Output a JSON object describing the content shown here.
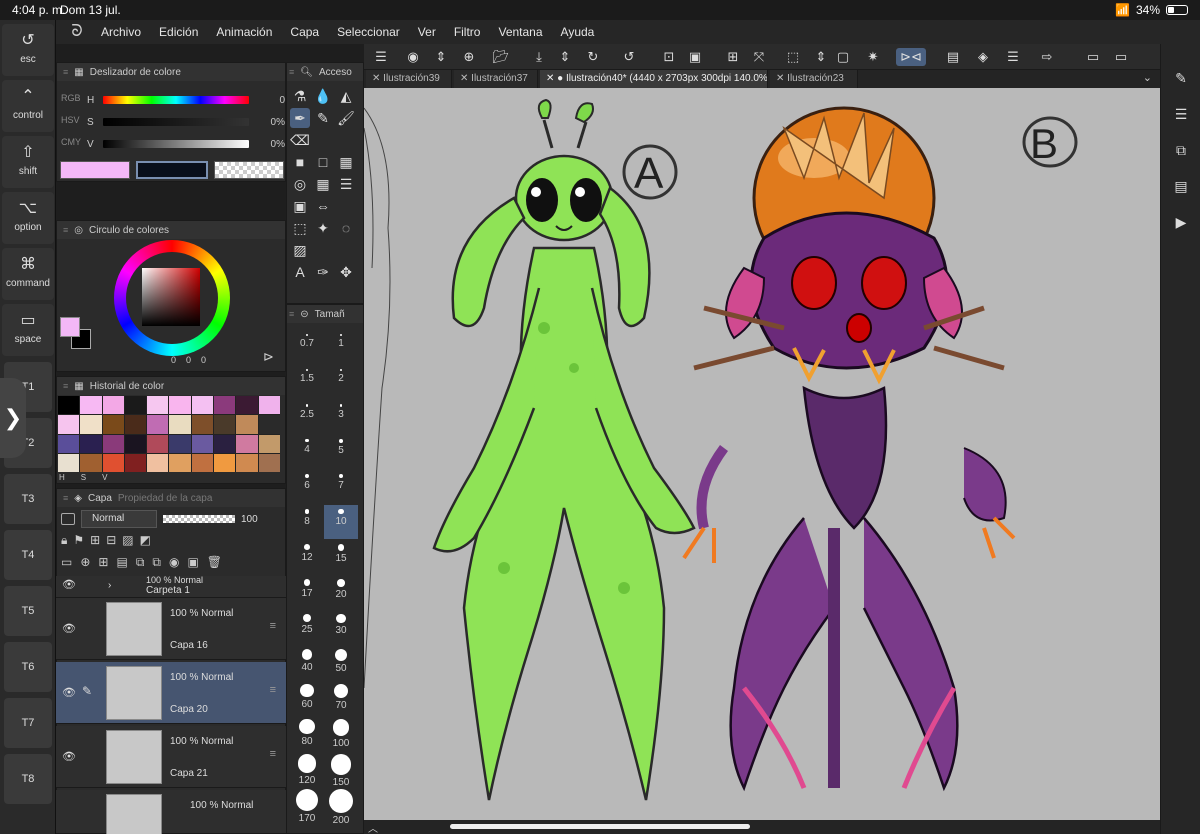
{
  "status": {
    "time": "4:04 p. m.",
    "date": "Dom 13 jul.",
    "battery": "34%"
  },
  "menu": [
    "Archivo",
    "Edición",
    "Animación",
    "Capa",
    "Seleccionar",
    "Ver",
    "Filtro",
    "Ventana",
    "Ayuda"
  ],
  "modifiers": [
    {
      "icon": "↺",
      "label": "esc"
    },
    {
      "icon": "⌃",
      "label": "control"
    },
    {
      "icon": "⇧",
      "label": "shift"
    },
    {
      "icon": "⌥",
      "label": "option"
    },
    {
      "icon": "⌘",
      "label": "command"
    },
    {
      "icon": "▭",
      "label": "space"
    }
  ],
  "tkeys": [
    "T1",
    "T2",
    "T3",
    "T4",
    "T5",
    "T6",
    "T7",
    "T8"
  ],
  "color_slider": {
    "title": "Deslizador de colore",
    "side_tabs": [
      "RGB",
      "HSV",
      "CMY"
    ],
    "rows": [
      {
        "key": "H",
        "value": "0"
      },
      {
        "key": "S",
        "value": "0%"
      },
      {
        "key": "V",
        "value": "0%"
      }
    ]
  },
  "color_circle": {
    "title": "Circulo de colores",
    "rgb_values": [
      "0",
      "0",
      "0"
    ]
  },
  "color_history": {
    "title": "Historial de color",
    "colors": [
      "#000000",
      "#f7b9f3",
      "#f3a8e6",
      "#1a1a1a",
      "#f6c7f0",
      "#f9b5ee",
      "#f4c0f2",
      "#8b3a7c",
      "#3b1a33",
      "#f0b2ec",
      "#f6c4ee",
      "#f0e0c8",
      "#7a4a1a",
      "#4a2b1a",
      "#c06cb3",
      "#e9dcc0",
      "#7e4f2a",
      "#4a3a2a",
      "#c08a5a",
      "#2a2a2a",
      "#5a4e9a",
      "#2a2050",
      "#8a3a7a",
      "#1a1420",
      "#b04a5a",
      "#3a3a6a",
      "#6a5aa0",
      "#2a2040",
      "#d07aa0",
      "#c29a6a",
      "#e8e0d0",
      "#a06030",
      "#e05030",
      "#802020",
      "#f0c0a0",
      "#e0a060",
      "#c07040",
      "#f09a40",
      "#d08a50",
      "#a07050"
    ],
    "bottom": [
      "H",
      "S",
      "V"
    ]
  },
  "layers": {
    "tabs": [
      "Capa",
      "Propiedad de la capa"
    ],
    "blend_mode": "Normal",
    "opacity": "100",
    "folder": {
      "mode": "100 % Normal",
      "name": "Carpeta 1"
    },
    "items": [
      {
        "mode": "100 %  Normal",
        "name": "Capa 16",
        "selected": false
      },
      {
        "mode": "100 %  Normal",
        "name": "Capa 20",
        "selected": true
      },
      {
        "mode": "100 %  Normal",
        "name": "Capa 21",
        "selected": false
      },
      {
        "mode": "100 %  Normal",
        "name": "",
        "selected": false
      }
    ]
  },
  "tool_panel": {
    "title": "Acceso",
    "brush_title": "Tamañ"
  },
  "brush_sizes": [
    "0.7",
    "1",
    "1.5",
    "2",
    "2.5",
    "3",
    "4",
    "5",
    "6",
    "7",
    "8",
    "10",
    "12",
    "15",
    "17",
    "20",
    "25",
    "30",
    "40",
    "50",
    "60",
    "70",
    "80",
    "100",
    "120",
    "150",
    "170",
    "200"
  ],
  "tabs": [
    {
      "label": "Ilustración39",
      "active": false
    },
    {
      "label": "Ilustración37",
      "active": false
    },
    {
      "label": "● Ilustración40* (4440 x 2703px 300dpi 140.0%)",
      "active": true
    },
    {
      "label": "Ilustración23",
      "active": false
    }
  ],
  "canvas": {
    "label_a": "A",
    "label_b": "B",
    "background": "#b9b9b9"
  }
}
